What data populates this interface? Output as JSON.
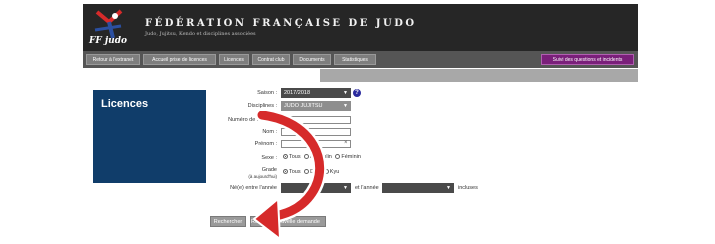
{
  "header": {
    "logo_text": "FF judo",
    "title": "FÉDÉRATION FRANÇAISE DE JUDO",
    "subtitle": "Judo, Jujitsu, Kendo et disciplines associées"
  },
  "nav": {
    "items": [
      "Retour à l'extranet",
      "Accueil prise de licences",
      "Licences",
      "Contrat club",
      "Documents",
      "Statistiques"
    ],
    "right_link": "Suivi des questions et incidents"
  },
  "panel": {
    "title": "Licences"
  },
  "form": {
    "saison": {
      "label": "Saison :",
      "value": "2017/2018"
    },
    "disciplines": {
      "label": "Disciplines :",
      "value": "JUDO JUJITSU"
    },
    "numero": {
      "label": "Numéro de licence :"
    },
    "nom": {
      "label": "Nom :"
    },
    "prenom": {
      "label": "Prénom :"
    },
    "clear_symbol": "×",
    "sexe": {
      "label": "Sexe :",
      "options": [
        "Tous",
        "Masculin",
        "Féminin"
      ]
    },
    "grade": {
      "label": "Grade",
      "sublabel": "(à aujourd'hui)",
      "options": [
        "Tous",
        "Dan",
        "Kyu"
      ]
    },
    "naissance": {
      "label": "Né(e) entre l'année",
      "middle": "et l'année",
      "suffix": "incluses"
    }
  },
  "buttons": {
    "search": "Rechercher",
    "other": "Reset",
    "third": "Nouvelle demande"
  },
  "colors": {
    "header_bg": "#262626",
    "nav_bg": "#555555",
    "panel_bg": "#103d6a",
    "accent_purple": "#7a1f7a",
    "arrow_red": "#d62a2a"
  }
}
